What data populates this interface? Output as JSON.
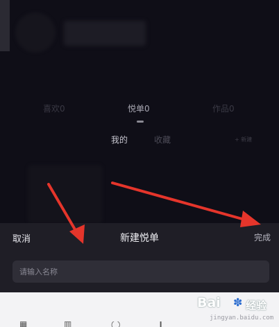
{
  "profile": {
    "tabs": [
      {
        "label": "喜欢0"
      },
      {
        "label": "悦单0"
      },
      {
        "label": "作品0"
      }
    ],
    "sub_tabs": [
      {
        "label": "我的"
      },
      {
        "label": "收藏"
      }
    ],
    "new_label": "+ 新建"
  },
  "sheet": {
    "cancel_label": "取消",
    "title": "新建悦单",
    "done_label": "完成",
    "input": {
      "placeholder": "请输入名称",
      "value": ""
    }
  },
  "watermark": {
    "brand": "Bai",
    "suffix": "经验",
    "url": "jingyan.baidu.com"
  },
  "colors": {
    "sheet_bg": "#1f1e26",
    "app_bg": "#0f0e17",
    "arrow": "#e5352b"
  }
}
